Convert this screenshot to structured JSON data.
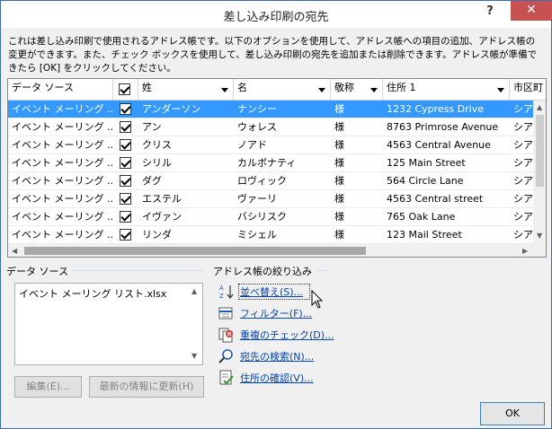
{
  "window": {
    "title": "差し込み印刷の宛先",
    "help": "?",
    "close": "✕"
  },
  "description": "これは差し込み印刷で使用されるアドレス帳です。以下のオプションを使用して、アドレス帳への項目の追加、アドレス帳の変更ができます。また、チェック ボックスを使用して、差し込み印刷の宛先を追加または削除できます。アドレス帳が準備できたら [OK] をクリックしてください。",
  "grid": {
    "headers": [
      "データ ソース",
      "",
      "姓",
      "名",
      "敬称",
      "住所 1",
      "市区町"
    ],
    "rows": [
      {
        "source": "イベント メーリング ...",
        "checked": true,
        "last": "アンダーソン",
        "first": "ナンシー",
        "title": "様",
        "address": "1232 Cypress Drive",
        "city": "シア",
        "selected": true
      },
      {
        "source": "イベント メーリング ...",
        "checked": true,
        "last": "アン",
        "first": "ウォレス",
        "title": "様",
        "address": "8763 Primrose Avenue",
        "city": "シア",
        "selected": false
      },
      {
        "source": "イベント メーリング ...",
        "checked": true,
        "last": "クリス",
        "first": "ノアド",
        "title": "様",
        "address": "4563 Central Avenue",
        "city": "シア",
        "selected": false
      },
      {
        "source": "イベント メーリング ...",
        "checked": true,
        "last": "シリル",
        "first": "カルボナティ",
        "title": "様",
        "address": "125 Main Street",
        "city": "シア",
        "selected": false
      },
      {
        "source": "イベント メーリング ...",
        "checked": true,
        "last": "ダグ",
        "first": "ロヴィック",
        "title": "様",
        "address": "564 Circle Lane",
        "city": "シア",
        "selected": false
      },
      {
        "source": "イベント メーリング ...",
        "checked": true,
        "last": "エステル",
        "first": "ヴァーリ",
        "title": "様",
        "address": "4563 Central street",
        "city": "シア",
        "selected": false
      },
      {
        "source": "イベント メーリング ...",
        "checked": true,
        "last": "イヴァン",
        "first": "バシリスク",
        "title": "様",
        "address": "765 Oak Lane",
        "city": "シア",
        "selected": false
      },
      {
        "source": "イベント メーリング ...",
        "checked": true,
        "last": "リンダ",
        "first": "ミシェル",
        "title": "様",
        "address": "123 Mail Street",
        "city": "シア",
        "selected": false
      }
    ]
  },
  "datasource": {
    "label": "データ ソース",
    "items": [
      "イベント メーリング リスト.xlsx"
    ],
    "edit_button": "編集(E)...",
    "refresh_button": "最新の情報に更新(H)"
  },
  "refine": {
    "label": "アドレス帳の絞り込み",
    "sort": "並べ替え(S)...",
    "filter": "フィルター(F)...",
    "duplicates": "重複のチェック(D)...",
    "find": "宛先の検索(N)...",
    "validate": "住所の確認(V)..."
  },
  "ok_button": "OK"
}
